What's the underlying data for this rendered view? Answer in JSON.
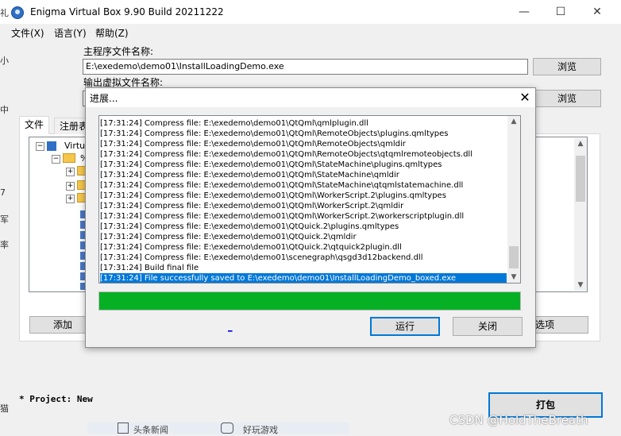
{
  "window": {
    "title": "Enigma Virtual Box 9.90 Build 20211222",
    "minimize": "—",
    "maximize": "☐",
    "close": "✕"
  },
  "menu": [
    "文件(X)",
    "语言(Y)",
    "帮助(Z)"
  ],
  "form": {
    "input_label": "主程序文件名称:",
    "input_path": "E:\\exedemo\\demo01\\InstallLoadingDemo.exe",
    "browse_label": "浏览",
    "output_label": "输出虚拟文件名称:",
    "browse2_label": "浏览"
  },
  "tabs": [
    "文件",
    "注册表"
  ],
  "tree": {
    "root_label": "Virtual",
    "child_fragment": "%"
  },
  "left_strip": [
    "礼",
    "小",
    "中",
    "7",
    "军",
    "率",
    "猫"
  ],
  "bottom": {
    "add_button": "添加",
    "options_button": "选项",
    "project_label": "* Project: New",
    "pack_button": "打包"
  },
  "dialog": {
    "title": "进展...",
    "close": "✕",
    "log_lines": [
      "[17:31:24] Compress file: E:\\exedemo\\demo01\\QtQml\\qmlplugin.dll",
      "[17:31:24] Compress file: E:\\exedemo\\demo01\\QtQml\\RemoteObjects\\plugins.qmltypes",
      "[17:31:24] Compress file: E:\\exedemo\\demo01\\QtQml\\RemoteObjects\\qmldir",
      "[17:31:24] Compress file: E:\\exedemo\\demo01\\QtQml\\RemoteObjects\\qtqmlremoteobjects.dll",
      "[17:31:24] Compress file: E:\\exedemo\\demo01\\QtQml\\StateMachine\\plugins.qmltypes",
      "[17:31:24] Compress file: E:\\exedemo\\demo01\\QtQml\\StateMachine\\qmldir",
      "[17:31:24] Compress file: E:\\exedemo\\demo01\\QtQml\\StateMachine\\qtqmlstatemachine.dll",
      "[17:31:24] Compress file: E:\\exedemo\\demo01\\QtQml\\WorkerScript.2\\plugins.qmltypes",
      "[17:31:24] Compress file: E:\\exedemo\\demo01\\QtQml\\WorkerScript.2\\qmldir",
      "[17:31:24] Compress file: E:\\exedemo\\demo01\\QtQml\\WorkerScript.2\\workerscriptplugin.dll",
      "[17:31:24] Compress file: E:\\exedemo\\demo01\\QtQuick.2\\plugins.qmltypes",
      "[17:31:24] Compress file: E:\\exedemo\\demo01\\QtQuick.2\\qmldir",
      "[17:31:24] Compress file: E:\\exedemo\\demo01\\QtQuick.2\\qtquick2plugin.dll",
      "[17:31:24] Compress file: E:\\exedemo\\demo01\\scenegraph\\qsgd3d12backend.dll",
      "[17:31:24] Build final file",
      "[17:31:24] File successfully saved to E:\\exedemo\\demo01\\InstallLoadingDemo_boxed.exe"
    ],
    "selected_line": 15,
    "progress": 1.0,
    "progress_color": "#06b025",
    "link_text": "_",
    "run_button": "运行",
    "close_button": "关闭"
  },
  "taskbar_fragments": [
    "头条新闻",
    "好玩游戏"
  ],
  "watermark": "CSDN @HoldTheBreath",
  "colors": {
    "accent": "#0078d7",
    "selection": "#0078d7"
  }
}
